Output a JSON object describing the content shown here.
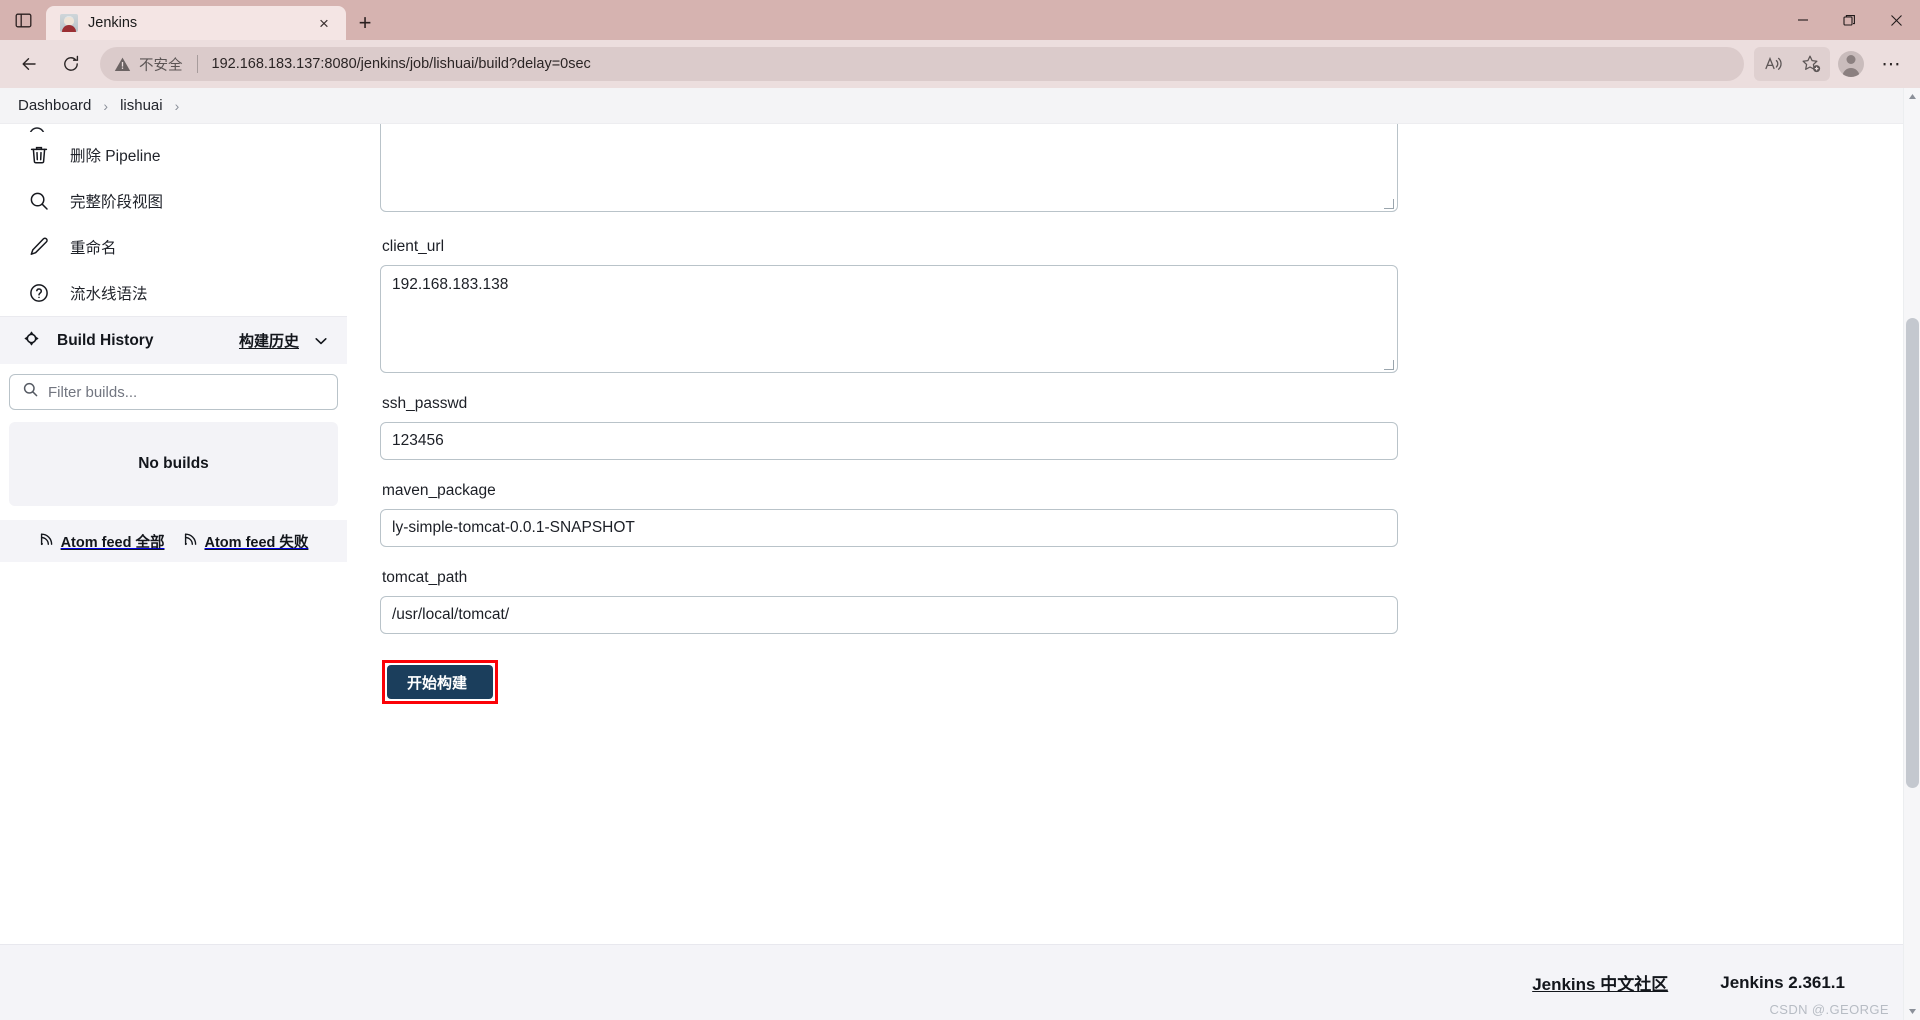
{
  "browser": {
    "tab": {
      "title": "Jenkins",
      "favicon": "jenkins-favicon",
      "close": "×"
    },
    "new_tab": "+",
    "window": {
      "minimize": "—",
      "maximize": "❐",
      "close": "✕"
    },
    "nav": {
      "back": "←",
      "reload": "↻"
    },
    "omnibox": {
      "security_label": "不安全",
      "url": "192.168.183.137:8080/jenkins/job/lishuai/build?delay=0sec"
    },
    "toolbar_right": {
      "read_aloud": "read-aloud-icon",
      "add_favorite": "add-favorite-icon",
      "profile": "profile-avatar",
      "settings": "⋯"
    }
  },
  "breadcrumb": {
    "items": [
      {
        "label": "Dashboard"
      },
      {
        "label": "lishuai"
      }
    ],
    "separator": "›"
  },
  "sidebar": {
    "items": [
      {
        "label": "删除 Pipeline",
        "icon": "trash-icon"
      },
      {
        "label": "完整阶段视图",
        "icon": "search-icon"
      },
      {
        "label": "重命名",
        "icon": "pencil-icon"
      },
      {
        "label": "流水线语法",
        "icon": "question-circle-icon"
      }
    ],
    "build_history": {
      "title": "Build History",
      "icon": "build-history-icon",
      "link": "构建历史",
      "chevron": "chevron-down-icon",
      "filter_placeholder": "Filter builds...",
      "empty_message": "No builds",
      "atom_feeds": [
        {
          "label": "Atom feed 全部",
          "icon": "rss-icon"
        },
        {
          "label": "Atom feed 失败",
          "icon": "rss-icon"
        }
      ]
    }
  },
  "form": {
    "fields": [
      {
        "name": "top_textarea",
        "label": "",
        "value": "",
        "type": "textarea"
      },
      {
        "name": "client_url",
        "label": "client_url",
        "value": "192.168.183.138",
        "type": "textarea"
      },
      {
        "name": "ssh_passwd",
        "label": "ssh_passwd",
        "value": "123456",
        "type": "text"
      },
      {
        "name": "maven_package",
        "label": "maven_package",
        "value": "ly-simple-tomcat-0.0.1-SNAPSHOT",
        "type": "text"
      },
      {
        "name": "tomcat_path",
        "label": "tomcat_path",
        "value": "/usr/local/tomcat/",
        "type": "text"
      }
    ],
    "submit_label": "开始构建"
  },
  "footer": {
    "community_link": "Jenkins 中文社区",
    "version": "Jenkins 2.361.1",
    "watermark": "CSDN @.GEORGE"
  },
  "colors": {
    "accent": "#1b3e5c",
    "highlight": "#fb0207",
    "chrome": "#d6b3b0",
    "toolbar": "#ecdede"
  }
}
